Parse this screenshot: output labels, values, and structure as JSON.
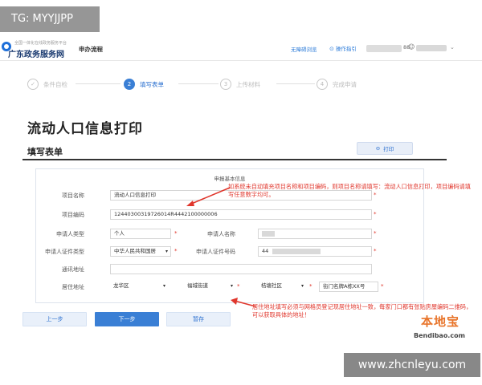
{
  "watermark_tag": "TG: MYYJJPP",
  "header": {
    "logo_small": "全国一体化在线政务服务平台",
    "logo_title": "广东政务服务网",
    "nav_process": "申办流程",
    "nav_barrier_free": "无障碍浏览",
    "nav_guide": "操作指引",
    "user_suffix": "88"
  },
  "steps": [
    {
      "num": "✓",
      "label": "条件自检",
      "active": false
    },
    {
      "num": "2",
      "label": "填写表单",
      "active": true
    },
    {
      "num": "3",
      "label": "上传材料",
      "active": false
    },
    {
      "num": "4",
      "label": "完成申请",
      "active": false
    }
  ],
  "page_title": "流动人口信息打印",
  "section_title": "填写表单",
  "print_button": "打印",
  "form": {
    "caption": "申报基本信息",
    "project_name_label": "项目名称",
    "project_name_value": "流动人口信息打印",
    "project_code_label": "项目编码",
    "project_code_value": "12440300319726014R4442100000006",
    "applicant_type_label": "申请人类型",
    "applicant_type_value": "个人",
    "applicant_name_label": "申请人名称",
    "id_type_label": "申请人证件类型",
    "id_type_value": "中华人民共和国居",
    "id_number_label": "申请人证件号码",
    "id_number_value": "44",
    "mail_address_label": "通讯地址",
    "residence_label": "居住地址",
    "residence_district": "龙华区",
    "residence_street": "福城街道",
    "residence_community": "桔塘社区",
    "residence_detail": "街门名牌A栋XX号",
    "required_mark": "*"
  },
  "annotations": {
    "top_note": "如系统未自动填充项目名称和项目编码，则项目名称请填写：流动人口信息打印，项目编码请填写任意数字均可。",
    "bottom_note": "居住地址填写必须与网格员登记现居住地址一致，每家门口都有张贴房屋编码二维码，可以获取具体的地址！"
  },
  "buttons": {
    "prev": "上一步",
    "next": "下一步",
    "save": "暂存"
  },
  "brand": {
    "logo": "本地宝",
    "url": "Bendibao.com"
  },
  "site_watermark": "www.zhcnleyu.com",
  "colors": {
    "accent": "#3a7fd5",
    "annotation": "#e0362c",
    "brand": "#e8742a"
  }
}
